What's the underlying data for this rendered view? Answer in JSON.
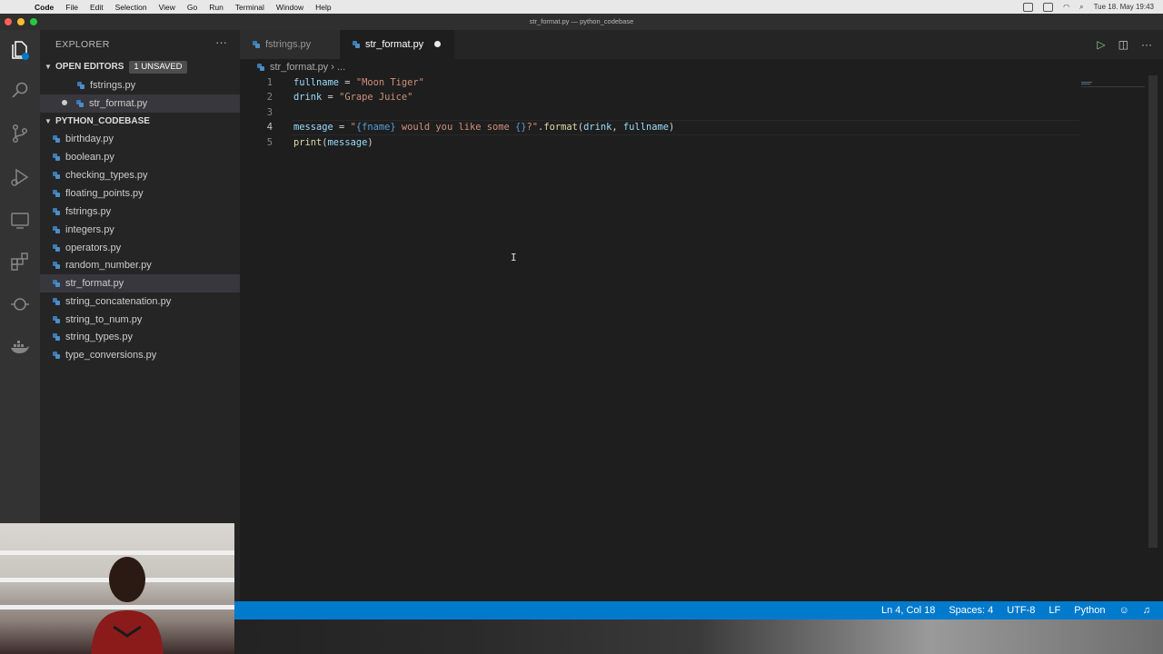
{
  "menubar": {
    "app": "Code",
    "items": [
      "File",
      "Edit",
      "Selection",
      "View",
      "Go",
      "Run",
      "Terminal",
      "Window",
      "Help"
    ],
    "datetime": "Tue 18. May 19:43"
  },
  "window": {
    "title": "str_format.py — python_codebase"
  },
  "explorer": {
    "header": "EXPLORER",
    "more": "···",
    "open_editors": {
      "label": "OPEN EDITORS",
      "badge": "1 UNSAVED",
      "files": [
        "fstrings.py",
        "str_format.py"
      ]
    },
    "folder": {
      "label": "PYTHON_CODEBASE",
      "files": [
        "birthday.py",
        "boolean.py",
        "checking_types.py",
        "floating_points.py",
        "fstrings.py",
        "integers.py",
        "operators.py",
        "random_number.py",
        "str_format.py",
        "string_concatenation.py",
        "string_to_num.py",
        "string_types.py",
        "type_conversions.py"
      ]
    }
  },
  "tabs": [
    {
      "label": "fstrings.py",
      "active": false
    },
    {
      "label": "str_format.py",
      "active": true,
      "modified": true
    }
  ],
  "breadcrumb": {
    "file": "str_format.py",
    "sep": "›",
    "more": "..."
  },
  "editor": {
    "line_numbers": [
      "1",
      "2",
      "3",
      "4",
      "5"
    ],
    "lines": [
      [
        "fullname",
        " = ",
        "\"Moon Tiger\""
      ],
      [
        "drink",
        " = ",
        "\"Grape Juice\""
      ],
      [],
      [
        "message",
        " = ",
        "\"",
        "{fname}",
        " would you like some ",
        "{}",
        "?\"",
        ".",
        "format",
        "(",
        "drink",
        ", ",
        "fullname",
        ")"
      ],
      [
        "print",
        "(",
        "message",
        ")"
      ]
    ]
  },
  "statusbar": {
    "position": "Ln 4, Col 18",
    "spaces": "Spaces: 4",
    "encoding": "UTF-8",
    "eol": "LF",
    "language": "Python"
  },
  "colors": {
    "status_bg": "#007acc",
    "activity_bg": "#333333",
    "sidebar_bg": "#252526",
    "editor_bg": "#1e1e1e"
  }
}
